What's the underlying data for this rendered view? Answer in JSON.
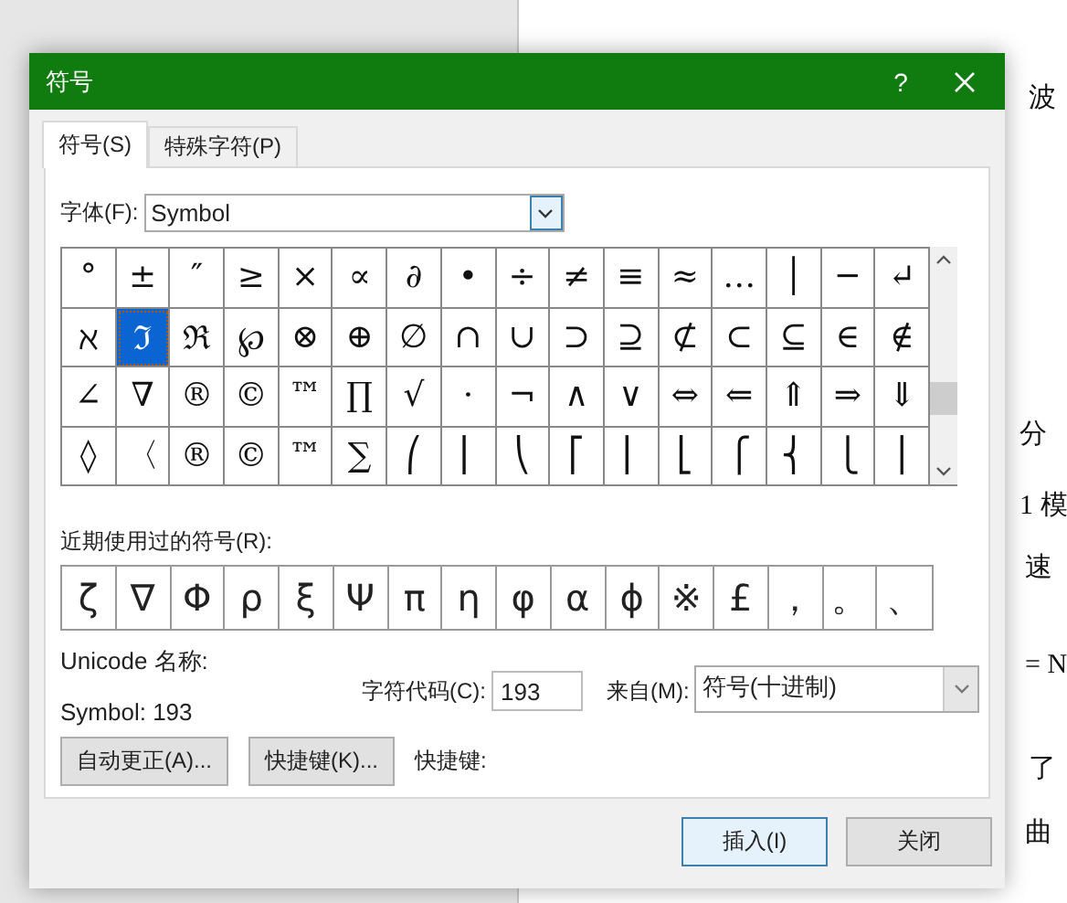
{
  "document": {
    "lines": [
      {
        "text": "波"
      },
      {
        "text": "分"
      },
      {
        "text": "1 模"
      },
      {
        "text": "速"
      },
      {
        "text": "= N"
      },
      {
        "text": "了"
      },
      {
        "text": "曲"
      }
    ]
  },
  "window": {
    "title": "符号",
    "help": "?"
  },
  "tabs": [
    {
      "label": "符号(S)",
      "selected": true
    },
    {
      "label": "特殊字符(P)",
      "selected": false
    }
  ],
  "font": {
    "label": "字体(F):",
    "value": "Symbol"
  },
  "symbols": [
    [
      {
        "char": "°",
        "selected": false
      },
      {
        "char": "±",
        "selected": false
      },
      {
        "char": "″",
        "selected": false
      },
      {
        "char": "≥",
        "selected": false
      },
      {
        "char": "×",
        "selected": false
      },
      {
        "char": "∝",
        "selected": false
      },
      {
        "char": "∂",
        "selected": false
      },
      {
        "char": "•",
        "selected": false
      },
      {
        "char": "÷",
        "selected": false
      },
      {
        "char": "≠",
        "selected": false
      },
      {
        "char": "≡",
        "selected": false
      },
      {
        "char": "≈",
        "selected": false
      },
      {
        "char": "…",
        "selected": false
      },
      {
        "char": "│",
        "selected": false
      },
      {
        "char": "─",
        "selected": false
      },
      {
        "char": "↵",
        "selected": false
      }
    ],
    [
      {
        "char": "ℵ",
        "selected": false
      },
      {
        "char": "ℑ",
        "selected": true
      },
      {
        "char": "ℜ",
        "selected": false
      },
      {
        "char": "℘",
        "selected": false
      },
      {
        "char": "⊗",
        "selected": false
      },
      {
        "char": "⊕",
        "selected": false
      },
      {
        "char": "∅",
        "selected": false
      },
      {
        "char": "∩",
        "selected": false
      },
      {
        "char": "∪",
        "selected": false
      },
      {
        "char": "⊃",
        "selected": false
      },
      {
        "char": "⊇",
        "selected": false
      },
      {
        "char": "⊄",
        "selected": false
      },
      {
        "char": "⊂",
        "selected": false
      },
      {
        "char": "⊆",
        "selected": false
      },
      {
        "char": "∈",
        "selected": false
      },
      {
        "char": "∉",
        "selected": false
      }
    ],
    [
      {
        "char": "∠",
        "selected": false
      },
      {
        "char": "∇",
        "selected": false
      },
      {
        "char": "®",
        "selected": false
      },
      {
        "char": "©",
        "selected": false
      },
      {
        "char": "™",
        "selected": false
      },
      {
        "char": "∏",
        "selected": false
      },
      {
        "char": "√",
        "selected": false
      },
      {
        "char": "⋅",
        "selected": false
      },
      {
        "char": "¬",
        "selected": false
      },
      {
        "char": "∧",
        "selected": false
      },
      {
        "char": "∨",
        "selected": false
      },
      {
        "char": "⇔",
        "selected": false
      },
      {
        "char": "⇐",
        "selected": false
      },
      {
        "char": "⇑",
        "selected": false
      },
      {
        "char": "⇒",
        "selected": false
      },
      {
        "char": "⇓",
        "selected": false
      }
    ],
    [
      {
        "char": "◊",
        "selected": false
      },
      {
        "char": "〈",
        "selected": false
      },
      {
        "char": "®",
        "selected": false
      },
      {
        "char": "©",
        "selected": false
      },
      {
        "char": "™",
        "selected": false
      },
      {
        "char": "∑",
        "selected": false
      },
      {
        "char": "⎛",
        "selected": false
      },
      {
        "char": "⎜",
        "selected": false
      },
      {
        "char": "⎝",
        "selected": false
      },
      {
        "char": "⎡",
        "selected": false
      },
      {
        "char": "⎢",
        "selected": false
      },
      {
        "char": "⎣",
        "selected": false
      },
      {
        "char": "⎧",
        "selected": false
      },
      {
        "char": "⎨",
        "selected": false
      },
      {
        "char": "⎩",
        "selected": false
      },
      {
        "char": "⎪",
        "selected": false
      }
    ]
  ],
  "recent": {
    "label": "近期使用过的符号(R):",
    "symbols": [
      "ζ",
      "∇",
      "Φ",
      "ρ",
      "ξ",
      "Ψ",
      "π",
      "η",
      "φ",
      "α",
      "ϕ",
      "※",
      "£",
      "，",
      "。",
      "、"
    ]
  },
  "unicode_name": {
    "label": "Unicode 名称:",
    "value": "Symbol: 193"
  },
  "char_code": {
    "label": "字符代码(C):",
    "value": "193"
  },
  "from": {
    "label": "来自(M):",
    "value": "符号(十进制)"
  },
  "buttons": [
    {
      "label": "自动更正(A)..."
    },
    {
      "label": "快捷键(K)..."
    }
  ],
  "shortcut_label": "快捷键:",
  "footer_buttons": [
    {
      "label": "插入(I)",
      "default": true
    },
    {
      "label": "关闭",
      "default": false
    }
  ]
}
